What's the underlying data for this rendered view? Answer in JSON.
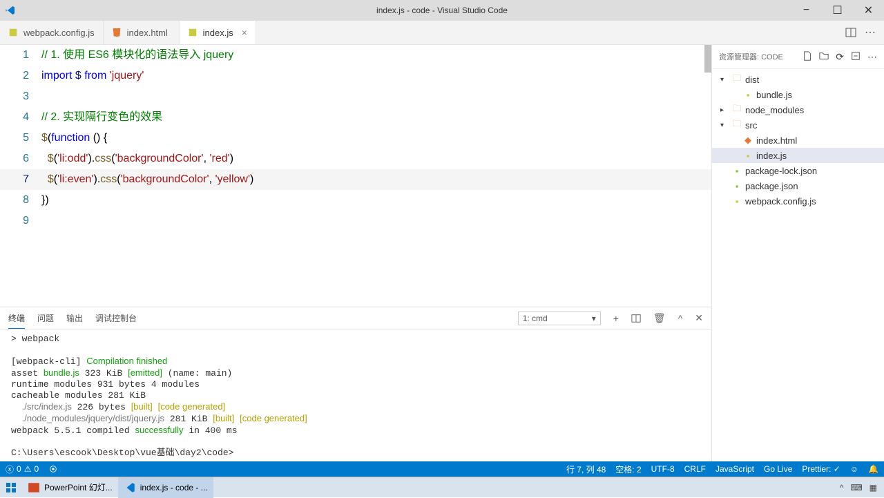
{
  "window": {
    "title": "index.js - code - Visual Studio Code"
  },
  "tabs": [
    {
      "name": "webpack.config.js",
      "icon": "js",
      "active": false
    },
    {
      "name": "index.html",
      "icon": "html",
      "active": false
    },
    {
      "name": "index.js",
      "icon": "js",
      "active": true
    }
  ],
  "explorer": {
    "title": "资源管理器: CODE",
    "tree": [
      {
        "type": "folder",
        "name": "dist",
        "expanded": true,
        "depth": 0
      },
      {
        "type": "file",
        "name": "bundle.js",
        "icon": "js",
        "depth": 1
      },
      {
        "type": "folder",
        "name": "node_modules",
        "expanded": false,
        "depth": 0
      },
      {
        "type": "folder",
        "name": "src",
        "expanded": true,
        "depth": 0
      },
      {
        "type": "file",
        "name": "index.html",
        "icon": "html",
        "depth": 1
      },
      {
        "type": "file",
        "name": "index.js",
        "icon": "js",
        "depth": 1,
        "selected": true
      },
      {
        "type": "file",
        "name": "package-lock.json",
        "icon": "json",
        "depth": 0
      },
      {
        "type": "file",
        "name": "package.json",
        "icon": "json",
        "depth": 0
      },
      {
        "type": "file",
        "name": "webpack.config.js",
        "icon": "js",
        "depth": 0
      }
    ]
  },
  "code": {
    "lines": [
      {
        "n": 1,
        "segments": [
          {
            "t": "// 1. 使用 ES6 模块化的语法导入 jquery",
            "c": "c-comment"
          }
        ]
      },
      {
        "n": 2,
        "segments": [
          {
            "t": "import",
            "c": "c-kw"
          },
          {
            "t": " "
          },
          {
            "t": "$",
            "c": "c-var"
          },
          {
            "t": " "
          },
          {
            "t": "from",
            "c": "c-kw"
          },
          {
            "t": " "
          },
          {
            "t": "'jquery'",
            "c": "c-str"
          }
        ]
      },
      {
        "n": 3,
        "segments": []
      },
      {
        "n": 4,
        "segments": [
          {
            "t": "// 2. 实现隔行变色的效果",
            "c": "c-comment"
          }
        ]
      },
      {
        "n": 5,
        "segments": [
          {
            "t": "$",
            "c": "c-func"
          },
          {
            "t": "("
          },
          {
            "t": "function",
            "c": "c-kw"
          },
          {
            "t": " () {"
          }
        ]
      },
      {
        "n": 6,
        "segments": [
          {
            "t": "  "
          },
          {
            "t": "$",
            "c": "c-func"
          },
          {
            "t": "("
          },
          {
            "t": "'li:odd'",
            "c": "c-str"
          },
          {
            "t": ")."
          },
          {
            "t": "css",
            "c": "c-func"
          },
          {
            "t": "("
          },
          {
            "t": "'backgroundColor'",
            "c": "c-str"
          },
          {
            "t": ", "
          },
          {
            "t": "'red'",
            "c": "c-str"
          },
          {
            "t": ")"
          }
        ]
      },
      {
        "n": 7,
        "current": true,
        "segments": [
          {
            "t": "  "
          },
          {
            "t": "$",
            "c": "c-func"
          },
          {
            "t": "("
          },
          {
            "t": "'li:even'",
            "c": "c-str"
          },
          {
            "t": ")."
          },
          {
            "t": "css",
            "c": "c-func"
          },
          {
            "t": "("
          },
          {
            "t": "'backgroundColor'",
            "c": "c-str"
          },
          {
            "t": ", "
          },
          {
            "t": "'yellow'",
            "c": "c-str"
          },
          {
            "t": ")"
          }
        ]
      },
      {
        "n": 8,
        "segments": [
          {
            "t": "})"
          }
        ]
      },
      {
        "n": 9,
        "segments": []
      }
    ]
  },
  "panel": {
    "tabs": [
      "终端",
      "问题",
      "输出",
      "调试控制台"
    ],
    "active_tab": 0,
    "selector": "1: cmd",
    "terminal_html": "> webpack\n\n[webpack-cli] <span class='t-green'>Compilation finished</span>\nasset <span class='t-green'>bundle.js</span> 323 KiB <span class='t-green'>[emitted]</span> (name: main)\nruntime modules 931 bytes 4 modules\ncacheable modules 281 KiB\n  <span class='t-dim'>./src/index.js</span> 226 bytes <span class='t-yellow'>[built]</span> <span class='t-yellow'>[code generated]</span>\n  <span class='t-dim'>./node_modules/jquery/dist/jquery.js</span> 281 KiB <span class='t-yellow'>[built]</span> <span class='t-yellow'>[code generated]</span>\nwebpack 5.5.1 compiled <span class='t-green'>successfully</span> in 400 ms\n\nC:\\Users\\escook\\Desktop\\vue基础\\day2\\code>"
  },
  "status": {
    "errors": "0",
    "warnings": "0",
    "ln_col": "行 7, 列 48",
    "spaces": "空格: 2",
    "encoding": "UTF-8",
    "eol": "CRLF",
    "lang": "JavaScript",
    "golive": "Go Live",
    "prettier": "Prettier: ✓"
  },
  "taskbar": {
    "items": [
      {
        "label": "PowerPoint 幻灯...",
        "icon": "ppt"
      },
      {
        "label": "index.js - code - ...",
        "icon": "vscode",
        "active": true
      }
    ]
  }
}
